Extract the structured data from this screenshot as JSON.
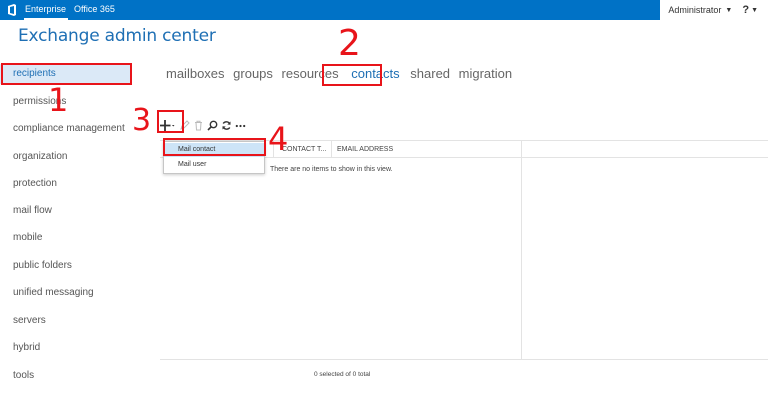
{
  "topbar": {
    "brand_icon": "office-logo-icon",
    "enterprise_label": "Enterprise",
    "office365_label": "Office 365",
    "user_label": "Administrator",
    "help_label": "?",
    "bar_color": "#0072c6"
  },
  "app": {
    "title": "Exchange admin center"
  },
  "nav": {
    "items": [
      "recipients",
      "permissions",
      "compliance management",
      "organization",
      "protection",
      "mail flow",
      "mobile",
      "public folders",
      "unified messaging",
      "servers",
      "hybrid",
      "tools"
    ],
    "selected": "recipients"
  },
  "tabs": {
    "items": [
      "mailboxes",
      "groups",
      "resources",
      "contacts",
      "shared",
      "migration"
    ],
    "selected": "contacts"
  },
  "toolbar": {
    "icons": [
      "add-icon",
      "edit-icon",
      "delete-icon",
      "search-icon",
      "refresh-icon",
      "more-icon"
    ]
  },
  "dropdown": {
    "items": [
      "Mail contact",
      "Mail user"
    ],
    "highlighted": "Mail contact"
  },
  "grid": {
    "columns": [
      "CONTACT T...",
      "EMAIL ADDRESS"
    ],
    "empty_message": "There are no items to show in this view.",
    "footer": "0 selected of 0 total"
  },
  "annotations": {
    "color": "#e8141a",
    "labels": [
      "1",
      "2",
      "3",
      "4"
    ]
  }
}
